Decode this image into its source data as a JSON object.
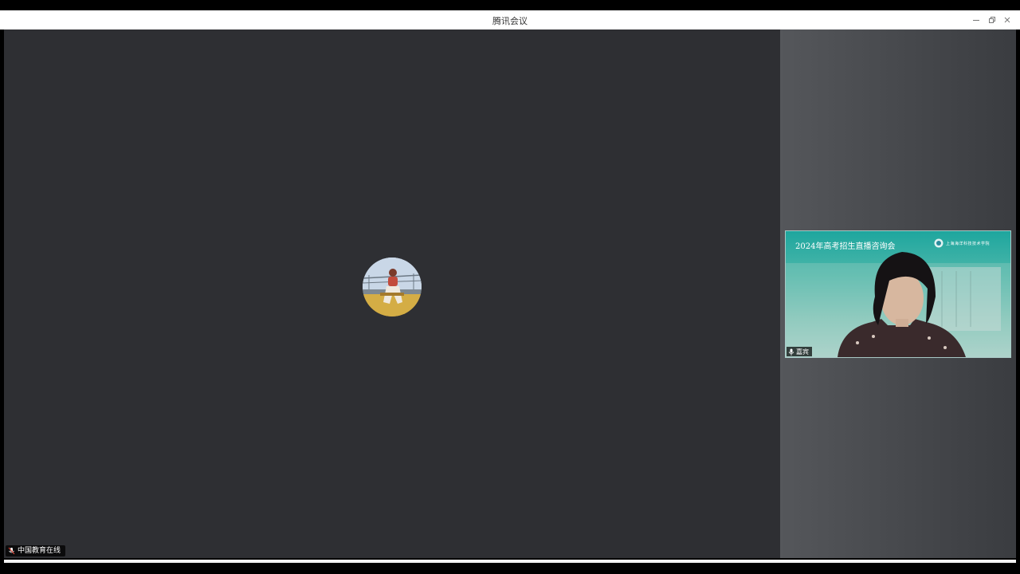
{
  "window": {
    "title": "腾讯会议",
    "controls": {
      "minimize_icon": "minimize-icon",
      "restore_icon": "restore-icon",
      "close_icon": "close-icon"
    }
  },
  "main_stage": {
    "participant_avatar": "avatar",
    "name_tag": {
      "icon": "mic-muted-icon",
      "label": "中国教育在线"
    }
  },
  "side_panel": {
    "video_tile": {
      "banner_text": "2024年高考招生直播咨询会",
      "school_name": "上海海洋科技技术学院",
      "name_tag": {
        "icon": "mic-icon",
        "label": "嘉宾"
      }
    }
  },
  "colors": {
    "stage_bg": "#2e2f33",
    "side_bg": "#4a4c50",
    "titlebar_bg": "#ffffff",
    "tile_accent": "#1ea69e"
  }
}
